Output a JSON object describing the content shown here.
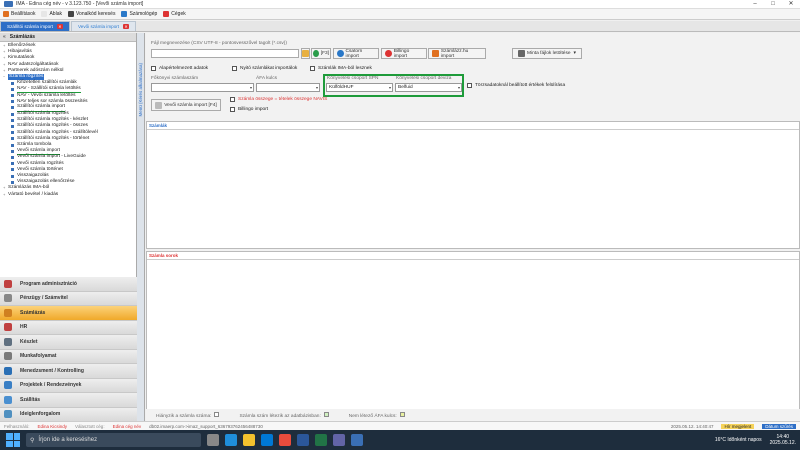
{
  "window": {
    "title": "IMA - Edina cég név - v 3.123.750 - [Vevői számla import]"
  },
  "menu": [
    {
      "label": "Beállítások",
      "color": "#e07020"
    },
    {
      "label": "Ablak",
      "color": "#e6e6e6"
    },
    {
      "label": "Vonalkód keresés",
      "color": "#444"
    },
    {
      "label": "Számológép",
      "color": "#2a78c8"
    },
    {
      "label": "Cégek",
      "color": "#d33"
    }
  ],
  "tabs": [
    {
      "label": "Szállítói számla import"
    },
    {
      "label": "Vevői számla import"
    }
  ],
  "sidebar": {
    "title": "Számlázás",
    "tree": [
      {
        "label": "Ellenőrzések",
        "child": false
      },
      {
        "label": "Hibajavítás",
        "child": false
      },
      {
        "label": "Kimutatások",
        "child": false
      },
      {
        "label": "NAV adatszolgáltatások",
        "child": false
      },
      {
        "label": "Partnerek adószám nélkül",
        "child": false
      },
      {
        "label": "Számla rögzítés",
        "child": false,
        "sel": true
      },
      {
        "label": "Kifizetetlen szállítói számlák",
        "child": true
      },
      {
        "label": "NAV - Szállítói számla letöltés",
        "child": true,
        "uline": true
      },
      {
        "label": "NAV - Vevői számla letöltés",
        "child": true
      },
      {
        "label": "NAV teljes sor számla összesítés",
        "child": true
      },
      {
        "label": "Szállítói számla import",
        "child": true,
        "uline": true
      },
      {
        "label": "Szállítói számla rögzítés",
        "child": true
      },
      {
        "label": "Szállítói számla rögzítés - készlet",
        "child": true
      },
      {
        "label": "Szállítói számla rögzítés - összes",
        "child": true
      },
      {
        "label": "Szállítói számla rögzítés - szállítólevél",
        "child": true
      },
      {
        "label": "Szállítói számla rögzítés - történet",
        "child": true
      },
      {
        "label": "Számla tombola",
        "child": true
      },
      {
        "label": "Vevői számla import",
        "child": true,
        "uline": true
      },
      {
        "label": "Vevői számla import - LiveGuide",
        "child": true
      },
      {
        "label": "Vevői számla rögzítés",
        "child": true
      },
      {
        "label": "Vevői számla történet",
        "child": true
      },
      {
        "label": "Visszaigazolás",
        "child": true
      },
      {
        "label": "Visszaigazolás ellenőrzése",
        "child": true
      },
      {
        "label": "Számlázás IMA-ból",
        "child": false
      },
      {
        "label": "Vártató bevétel / kiadás",
        "child": false
      }
    ]
  },
  "modules": [
    {
      "label": "Program adminisztráció",
      "color": "#c04040"
    },
    {
      "label": "Pénzügy / Számvitel",
      "color": "#888"
    },
    {
      "label": "Számlázás",
      "color": "#d08020",
      "active": true
    },
    {
      "label": "HR",
      "color": "#c04040"
    },
    {
      "label": "Készlet",
      "color": "#607080"
    },
    {
      "label": "Munkafolyamat",
      "color": "#7a7a7a"
    },
    {
      "label": "Menedzsment / Kontrolling",
      "color": "#2a6fb5"
    },
    {
      "label": "Projektek / Rendezvények",
      "color": "#3a7fc5"
    },
    {
      "label": "Szállítás",
      "color": "#4a8fd0"
    },
    {
      "label": "Ideiglenforgalom",
      "color": "#5090c0"
    }
  ],
  "vstrip": {
    "label": "Menü (Kérés alkalmazása)"
  },
  "form": {
    "file_label": "Fájl megnevezése (CSV UTF-8 - pontosvesszővel tagolt (*.csv))",
    "file_value": "",
    "f3": "[F3]",
    "btn_csv": "Csatorn import",
    "btn_billingo": "Billingo import",
    "btn_szamlazz": "Számlázz.hu import",
    "btn_minta": "Minta fájlok letöltése",
    "cb_alapertelmezett": "Alapértelmezett adatok",
    "cb_nyitott": "Nyitó számlákat importálok",
    "cb_ima": "Számlák IMA-ból lesznek",
    "lbl_fokonyvi": "Főkönyvi számlaszám",
    "lbl_afa": "ÁFA kulcs",
    "lbl_csoport_spn": "Könyvelési csoport SPN",
    "lbl_csoport_deviza": "Könyvelési csoport deviza",
    "val_csoport_spn": "KülföldHUF",
    "val_csoport_deviza": "Belfuid",
    "cb_torzsadat": "Törzsadatoknál beállított értékek felülírása",
    "btn_import": "Vevői számla import [F4]",
    "cb_osszeg": "Számla összege = tételek összege NAVIS",
    "cb_billingo": "Billingo import"
  },
  "panels": {
    "szamlak": "Számlák",
    "szamla_sorok": "Számla sorok"
  },
  "legend": [
    {
      "label": "Hiányzik a számla száma:",
      "color": "#ffffff"
    },
    {
      "label": "Számla szám létezik az adatbázisban:",
      "color": "#d0f0c0"
    },
    {
      "label": "Nem létező ÁFA kulcs:",
      "color": "#e8f0a0"
    }
  ],
  "appstatus": {
    "user_label": "Felhasználó:",
    "user": "Edina Kicsindy",
    "company_label": "Választott cég:",
    "company": "Edina cég név",
    "db": "db02.imaerp.com->ima2_support_636793762456488730",
    "datetime": "2025.05.12. 14:40:47",
    "msg": "Hír megjelent",
    "date_btn": "Dátum szűrés"
  },
  "taskbar": {
    "search": "Írjon ide a kereséshez",
    "weather": "16°C Időnként napos",
    "time": "14:40",
    "date": "2025.05.12."
  }
}
